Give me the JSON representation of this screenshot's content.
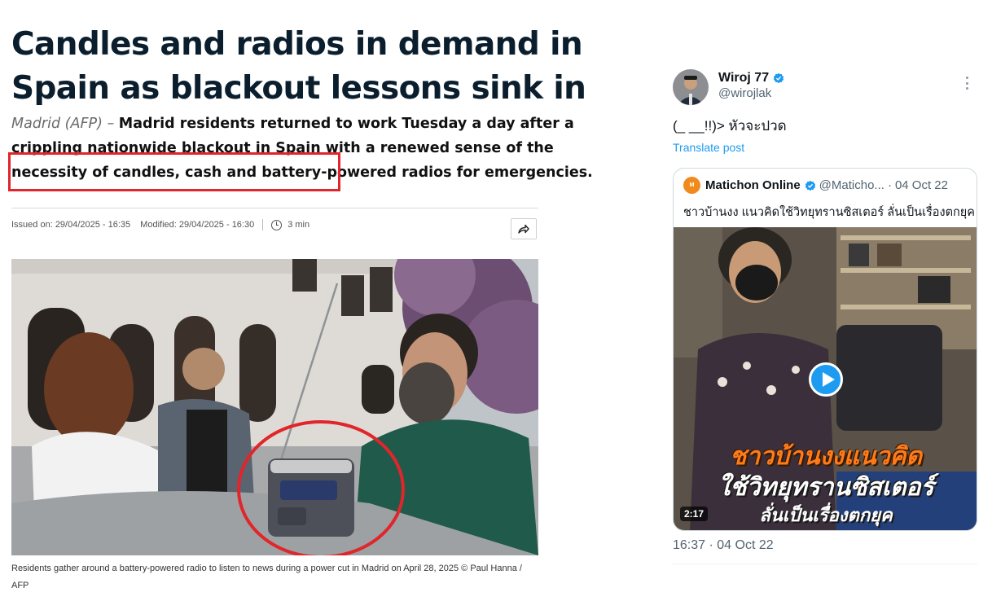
{
  "article": {
    "title": "Candles and radios in demand in Spain as blackout lessons sink in",
    "dateline": "Madrid (AFP) –",
    "lede": "Madrid residents returned to work Tuesday a day after a crippling nationwide blackout in Spain with a renewed sense of the necessity of candles, cash and battery-powered radios for emergencies.",
    "issued": "Issued on: 29/04/2025 - 16:35",
    "modified": "Modified: 29/04/2025 - 16:30",
    "read_time": "3 min",
    "caption": "Residents gather around a battery-powered radio to listen to news during a power cut in Madrid on April 28, 2025 © Paul Hanna / AFP",
    "colors": {
      "highlight": "#e0262b",
      "title": "#0b1e2e"
    }
  },
  "tweet": {
    "name": "Wiroj 77",
    "handle": "@wirojlak",
    "text": "(_ __!!)> หัวจะปวด",
    "translate": "Translate post",
    "time": "16:37 · 04 Oct 22",
    "quoted": {
      "name": "Matichon Online",
      "handle": "@Maticho...",
      "date": "04 Oct 22",
      "text": "ชาวบ้านงง แนวคิดใช้วิทยุทรานซิสเตอร์ ลั่นเป็นเรื่องตกยุค",
      "overlay_line1": "ชาวบ้านงงแนวคิด",
      "overlay_line2": "ใช้วิทยุทรานซิสเตอร์",
      "overlay_line3": "ลั่นเป็นเรื่องตกยุค",
      "duration": "2:17"
    },
    "colors": {
      "link": "#1d9bf0",
      "secondary": "#536471",
      "verified": "#1d9bf0",
      "brand": "#f18a1c"
    }
  },
  "icons": [
    "share-icon",
    "clock-icon",
    "verified-icon",
    "more-icon",
    "play-icon"
  ]
}
